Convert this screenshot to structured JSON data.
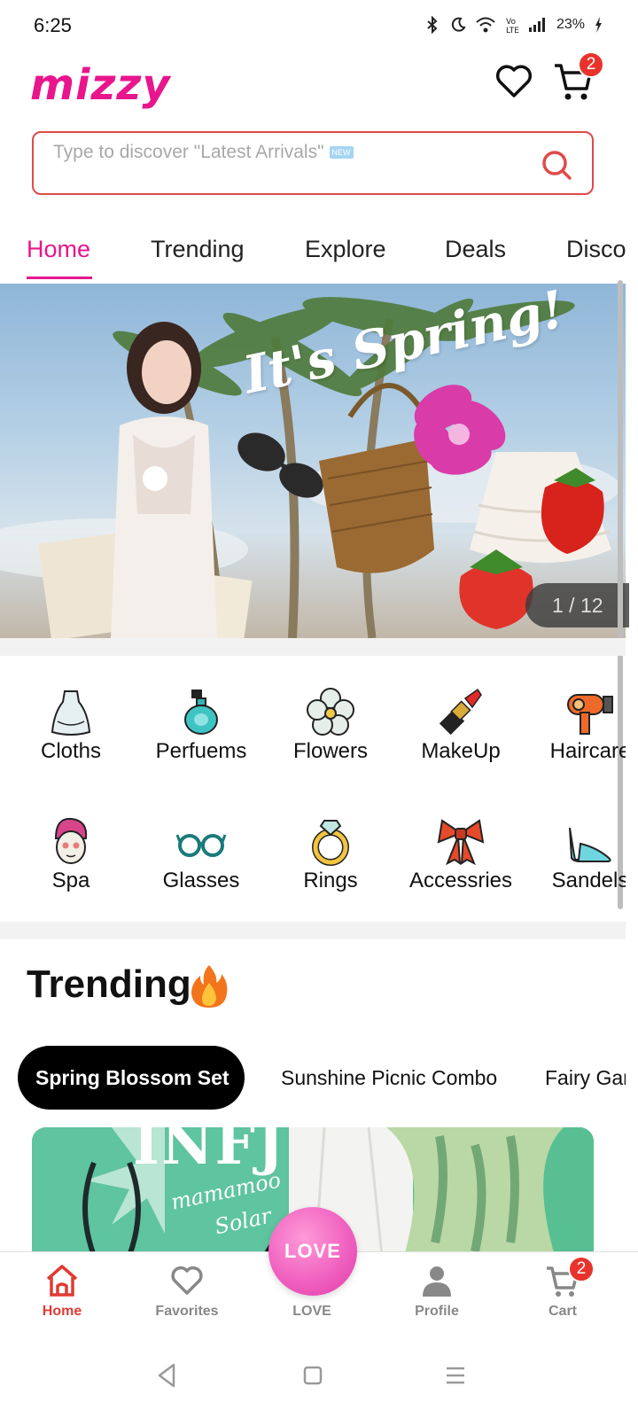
{
  "status_bar": {
    "time": "6:25",
    "battery": "23%",
    "icons": [
      "bluetooth-icon",
      "moon-icon",
      "wifi-icon",
      "volte-icon",
      "signal-icon",
      "charging-icon"
    ]
  },
  "header": {
    "logo": "mizzy",
    "cart_count": "2",
    "brand_color": "#e8158c"
  },
  "search": {
    "placeholder": "Type to discover \"Latest Arrivals\"",
    "new_tag": "NEW"
  },
  "tabs": [
    {
      "label": "Home",
      "active": true
    },
    {
      "label": "Trending",
      "active": false
    },
    {
      "label": "Explore",
      "active": false
    },
    {
      "label": "Deals",
      "active": false
    },
    {
      "label": "Disco",
      "active": false
    }
  ],
  "banner": {
    "title": "It's Spring!",
    "counter": "1 / 12"
  },
  "categories": [
    {
      "label": "Cloths",
      "icon": "dress-icon"
    },
    {
      "label": "Perfuems",
      "icon": "perfume-icon"
    },
    {
      "label": "Flowers",
      "icon": "flower-icon"
    },
    {
      "label": "MakeUp",
      "icon": "lipstick-icon"
    },
    {
      "label": "Haircare",
      "icon": "hairdryer-icon"
    },
    {
      "label": "Spa",
      "icon": "face-mask-icon"
    },
    {
      "label": "Glasses",
      "icon": "glasses-icon"
    },
    {
      "label": "Rings",
      "icon": "ring-icon"
    },
    {
      "label": "Accessries",
      "icon": "bow-icon"
    },
    {
      "label": "Sandels",
      "icon": "heel-icon"
    }
  ],
  "trending": {
    "title": "Trending",
    "chips": [
      {
        "label": "Spring Blossom Set",
        "active": true
      },
      {
        "label": "Sunshine Picnic Combo",
        "active": false
      },
      {
        "label": "Fairy Gar",
        "active": false
      }
    ],
    "card": {
      "text1": "INFJ",
      "text2": "mamamoo",
      "text3": "Solar"
    }
  },
  "bottom_nav": {
    "items": [
      {
        "label": "Home",
        "active": true
      },
      {
        "label": "Favorites",
        "active": false
      },
      {
        "label": "LOVE",
        "active": false
      },
      {
        "label": "Profile",
        "active": false
      },
      {
        "label": "Cart",
        "active": false
      }
    ],
    "love_bubble": "LOVE",
    "cart_count": "2",
    "active_color": "#e03a32"
  }
}
